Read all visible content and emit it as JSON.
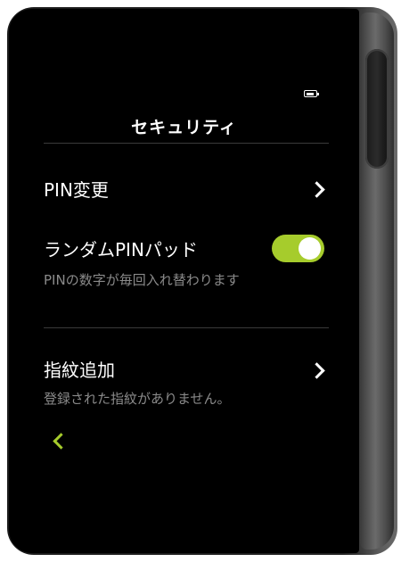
{
  "status": {
    "battery_icon": "battery-icon"
  },
  "header": {
    "title": "セキュリティ"
  },
  "settings": {
    "pin_change": {
      "label": "PIN変更",
      "icon": "chevron-right-icon"
    },
    "random_pin_pad": {
      "label": "ランダムPINパッド",
      "description": "PINの数字が毎回入れ替わります",
      "enabled": true
    },
    "add_fingerprint": {
      "label": "指紋追加",
      "description": "登録された指紋がありません。",
      "icon": "chevron-right-icon"
    }
  },
  "navigation": {
    "back_icon": "chevron-left-icon"
  },
  "colors": {
    "accent": "#a6cc2c",
    "background": "#000000",
    "text_primary": "#ffffff",
    "text_secondary": "#8a8a8a",
    "divider": "#3a3a3a"
  }
}
